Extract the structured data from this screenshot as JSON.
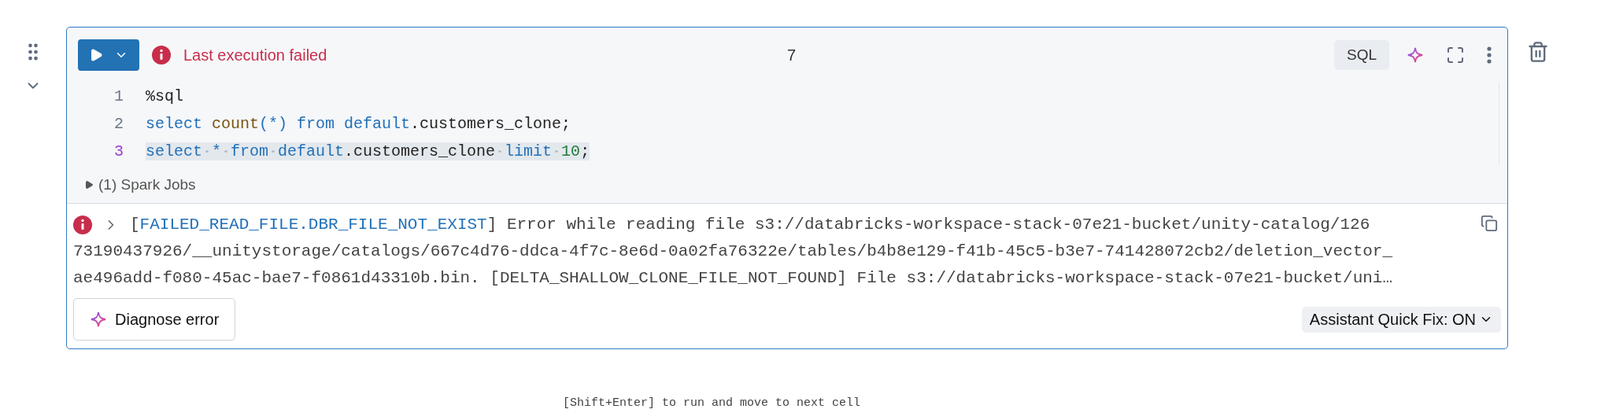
{
  "cell": {
    "status": {
      "kind": "error",
      "text": "Last execution failed"
    },
    "execution_count": "7",
    "language": "SQL",
    "code": [
      {
        "number": "1",
        "selected": false,
        "tokens": [
          {
            "kind": "plain",
            "text": "%sql"
          }
        ]
      },
      {
        "number": "2",
        "selected": false,
        "tokens": [
          {
            "kind": "keyword",
            "text": "select "
          },
          {
            "kind": "function",
            "text": "count"
          },
          {
            "kind": "keyword",
            "text": "(*)"
          },
          {
            "kind": "keyword",
            "text": " from default"
          },
          {
            "kind": "plain",
            "text": ".customers_clone;"
          }
        ]
      },
      {
        "number": "3",
        "selected": true,
        "tokens": [
          {
            "kind": "keyword",
            "text": "select * from default"
          },
          {
            "kind": "plain",
            "text": ".customers_clone "
          },
          {
            "kind": "keyword",
            "text": "limit "
          },
          {
            "kind": "number",
            "text": "10"
          },
          {
            "kind": "plain",
            "text": ";"
          }
        ]
      }
    ],
    "spark_jobs": {
      "label": "(1) Spark Jobs",
      "expanded": false
    },
    "error": {
      "expanded": false,
      "open_bracket": "[",
      "code": "FAILED_READ_FILE.DBR_FILE_NOT_EXIST",
      "lines": [
        "] Error while reading file s3://databricks-workspace-stack-07e21-bucket/unity-catalog/126",
        "73190437926/__unitystorage/catalogs/667c4d76-ddca-4f7c-8e6d-0a02fa76322e/tables/b4b8e129-f41b-45c5-b3e7-741428072cb2/deletion_vector_",
        "ae496add-f080-45ac-bae7-f0861d43310b.bin. [DELTA_SHALLOW_CLONE_FILE_NOT_FOUND] File s3://databricks-workspace-stack-07e21-bucket/uni…"
      ]
    },
    "diagnose_button": "Diagnose error",
    "quick_fix": "Assistant Quick Fix: ON"
  },
  "hint": "[Shift+Enter] to run and move to next cell"
}
